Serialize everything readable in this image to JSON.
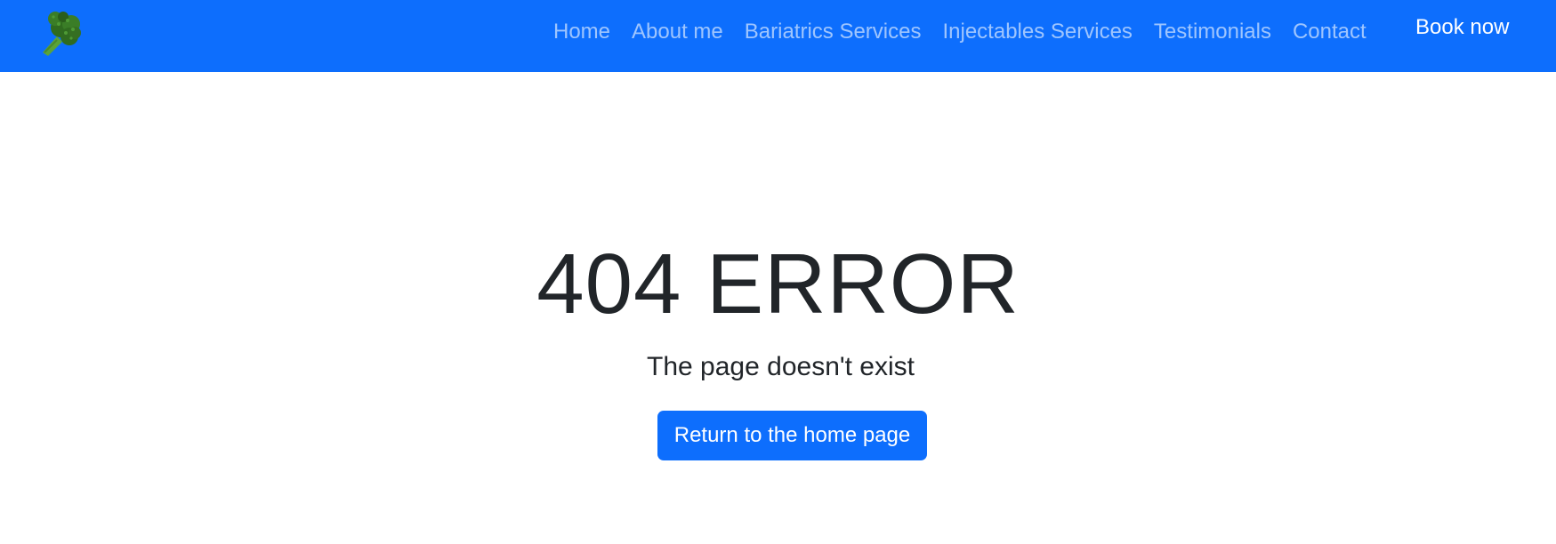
{
  "header": {
    "brand_color": "#0d6efd",
    "logo_icon": "broccoli-icon",
    "nav": [
      {
        "label": "Home"
      },
      {
        "label": "About me"
      },
      {
        "label": "Bariatrics Services"
      },
      {
        "label": "Injectables Services"
      },
      {
        "label": "Testimonials"
      },
      {
        "label": "Contact"
      }
    ],
    "book_label": "Book now"
  },
  "main": {
    "title": "404 ERROR",
    "subtitle": "The page doesn't exist",
    "home_button_label": "Return to the home page"
  }
}
